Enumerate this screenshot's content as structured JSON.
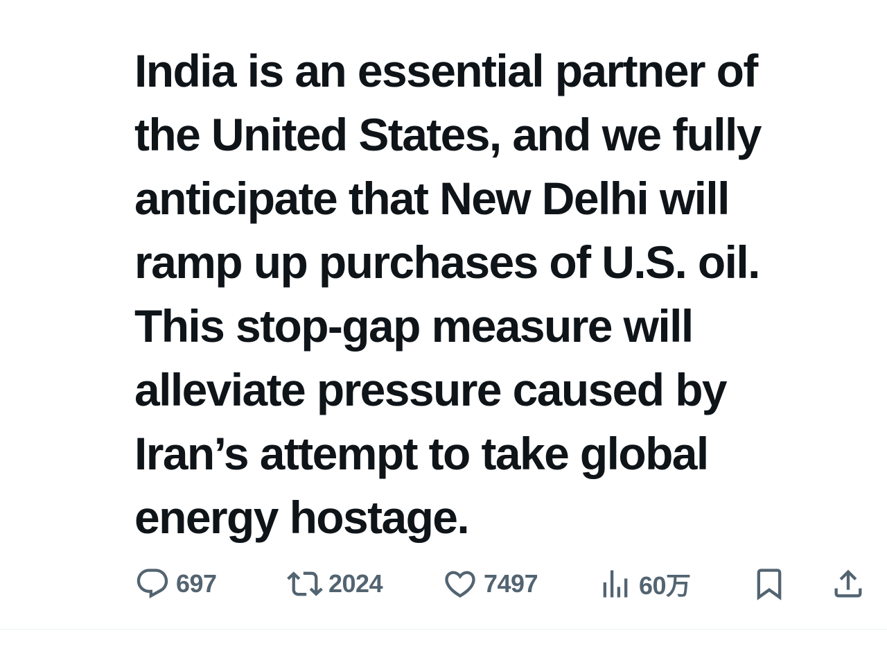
{
  "tweet": {
    "text_lines": [
      "India is an essential partner of",
      "the United States, and we fully",
      "anticipate that New Delhi will",
      "ramp up purchases of U.S. oil.",
      "This stop-gap measure will",
      "alleviate pressure caused by",
      "Iran’s attempt to take global",
      "energy hostage."
    ]
  },
  "actions": {
    "replies": "697",
    "retweets": "2024",
    "likes": "7497",
    "views": "60万",
    "icons": {
      "reply": "reply-bubble-icon",
      "retweet": "retweet-icon",
      "like": "heart-icon",
      "views": "views-chart-icon",
      "bookmark": "bookmark-icon",
      "share": "share-upload-icon"
    },
    "icon_color": "#536471"
  },
  "colors": {
    "text": "#0f1419",
    "background": "#ffffff",
    "divider": "#eff3f4"
  }
}
